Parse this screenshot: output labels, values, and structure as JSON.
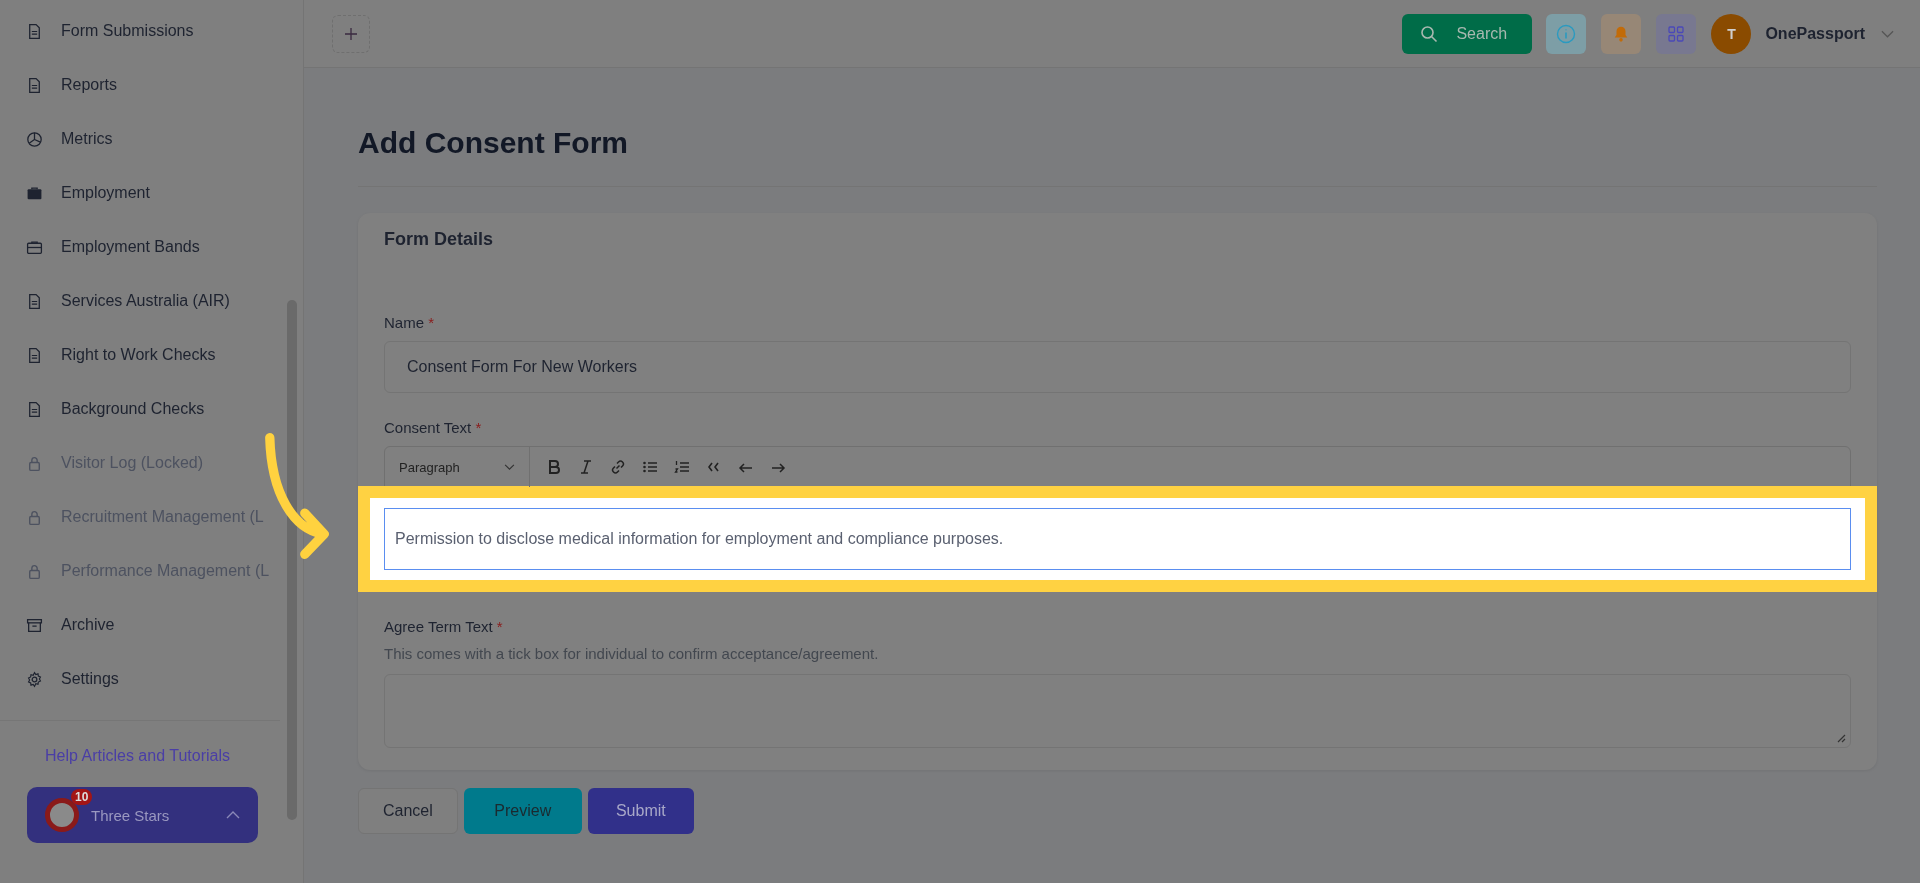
{
  "sidebar": {
    "items": [
      {
        "label": "Form Submissions",
        "locked": false
      },
      {
        "label": "Reports",
        "locked": false
      },
      {
        "label": "Metrics",
        "locked": false
      },
      {
        "label": "Employment",
        "locked": false
      },
      {
        "label": "Employment Bands",
        "locked": false
      },
      {
        "label": "Services Australia (AIR)",
        "locked": false
      },
      {
        "label": "Right to Work Checks",
        "locked": false
      },
      {
        "label": "Background Checks",
        "locked": false
      },
      {
        "label": "Visitor Log (Locked)",
        "locked": true
      },
      {
        "label": "Recruitment Management (L",
        "locked": true
      },
      {
        "label": "Performance Management (L",
        "locked": true
      },
      {
        "label": "Archive",
        "locked": false
      },
      {
        "label": "Settings",
        "locked": false
      }
    ],
    "help_link": "Help Articles and Tutorials",
    "account_card": {
      "badge": "10",
      "name": "Three Stars"
    }
  },
  "header": {
    "search_button": "Search",
    "avatar": "T",
    "user": "OnePassport"
  },
  "page": {
    "title": "Add Consent Form",
    "card": {
      "title": "Form Details",
      "name": {
        "label": "Name",
        "required": "*",
        "value": "Consent Form For New Workers"
      },
      "consent": {
        "label": "Consent Text",
        "required": "*",
        "format": "Paragraph",
        "value": "Permission to disclose medical information for employment and compliance purposes.",
        "highlighted": true
      },
      "agree": {
        "label": "Agree Term Text",
        "required": "*",
        "hint": "This comes with a tick box for individual to confirm acceptance/agreement."
      }
    },
    "buttons": [
      {
        "label": "Cancel",
        "kind": "plain"
      },
      {
        "label": "Preview",
        "kind": "preview"
      },
      {
        "label": "Submit",
        "kind": "submit"
      }
    ]
  }
}
